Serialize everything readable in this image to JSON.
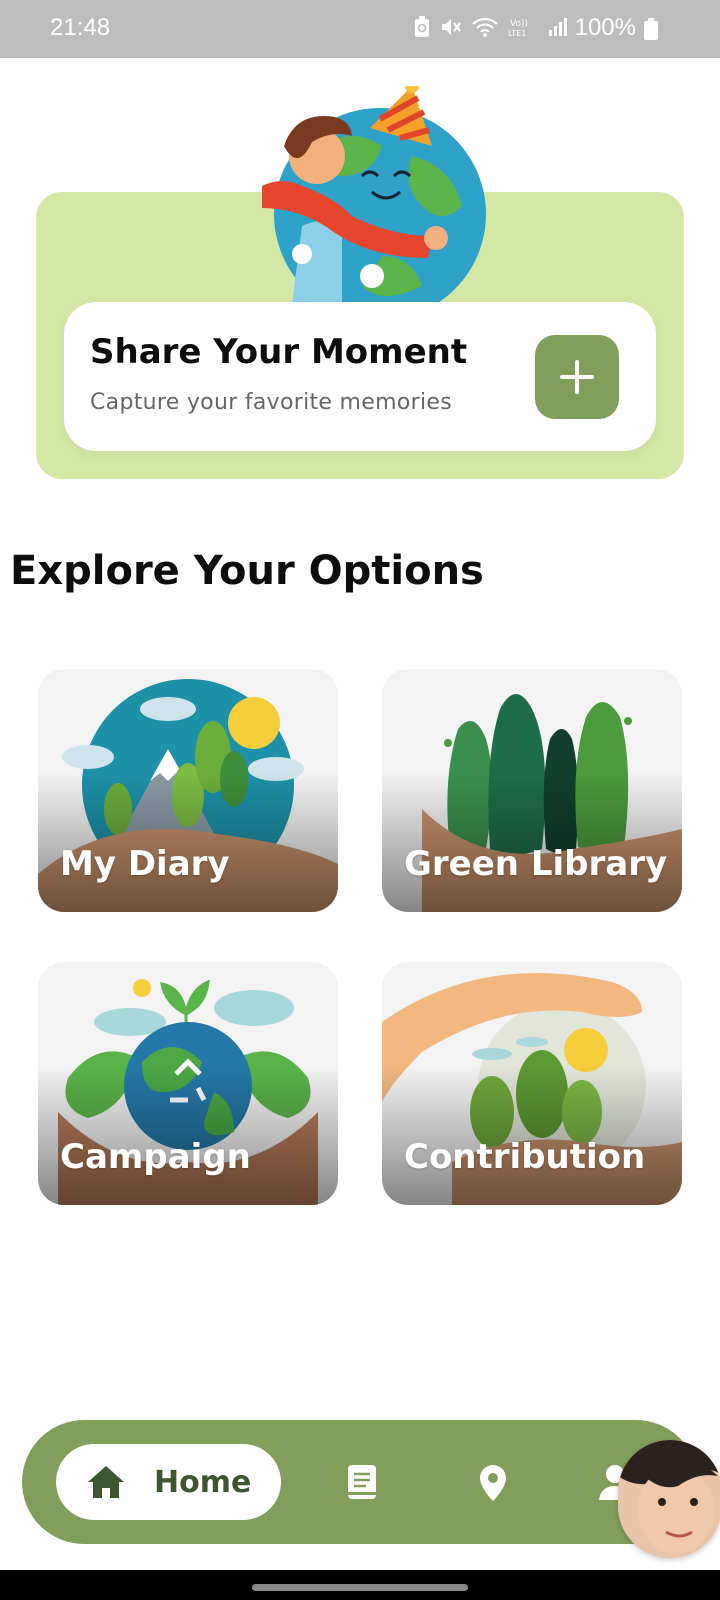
{
  "status_bar": {
    "time": "21:48",
    "battery": "100%",
    "icons": [
      "battery-saver-icon",
      "mute-icon",
      "wifi-icon",
      "volte-icon",
      "signal-icon",
      "battery-icon"
    ]
  },
  "hero": {
    "illustration": "child-hugging-earth-illustration",
    "title": "Share Your Moment",
    "subtitle": "Capture your favorite memories",
    "add_icon": "plus-icon",
    "colors": {
      "hero_bg": "#d2e8a4",
      "accent": "#819e5a"
    }
  },
  "explore": {
    "title": "Explore Your Options",
    "options": [
      {
        "label": "My Diary",
        "image": "mountain-landscape-in-hand-illustration"
      },
      {
        "label": "Green Library",
        "image": "trees-in-hand-illustration"
      },
      {
        "label": "Campaign",
        "image": "recycling-earth-in-hands-illustration"
      },
      {
        "label": "Contribution",
        "image": "hands-protecting-trees-illustration"
      }
    ]
  },
  "bottom_nav": {
    "items": [
      {
        "label": "Home",
        "icon": "home-icon",
        "active": true
      },
      {
        "label": "",
        "icon": "book-icon",
        "active": false
      },
      {
        "label": "",
        "icon": "location-pin-icon",
        "active": false
      },
      {
        "label": "",
        "icon": "person-icon",
        "active": false
      }
    ],
    "avatar": "user-avatar"
  }
}
